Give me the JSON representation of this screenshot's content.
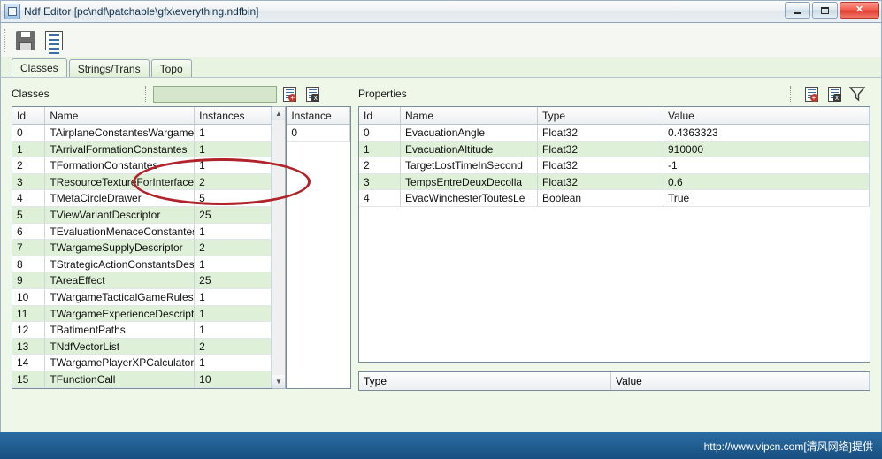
{
  "window": {
    "title": "Ndf Editor [pc\\ndf\\patchable\\gfx\\everything.ndfbin]",
    "icon": "app-icon",
    "minimize_label": "–",
    "maximize_label": "❐",
    "close_label": "✕"
  },
  "toolbar": {
    "save_icon": "save-icon",
    "list_icon": "list-icon"
  },
  "tabs": [
    {
      "label": "Classes",
      "active": true
    },
    {
      "label": "Strings/Trans",
      "active": false
    },
    {
      "label": "Topo",
      "active": false
    }
  ],
  "classes_pane": {
    "title": "Classes",
    "search_value": "",
    "search_placeholder": "",
    "add_icon": "doc-add-icon",
    "remove_icon": "doc-remove-icon",
    "columns": [
      "Id",
      "Name",
      "Instances"
    ],
    "instance_column": "Instance",
    "instance_rows": [
      "0"
    ],
    "rows": [
      {
        "id": "0",
        "name": "TAirplaneConstantesWargame",
        "instances": "1"
      },
      {
        "id": "1",
        "name": "TArrivalFormationConstantes",
        "instances": "1"
      },
      {
        "id": "2",
        "name": "TFormationConstantes",
        "instances": "1"
      },
      {
        "id": "3",
        "name": "TResourceTextureForInterface",
        "instances": "2"
      },
      {
        "id": "4",
        "name": "TMetaCircleDrawer",
        "instances": "5"
      },
      {
        "id": "5",
        "name": "TViewVariantDescriptor",
        "instances": "25"
      },
      {
        "id": "6",
        "name": "TEvaluationMenaceConstantes",
        "instances": "1"
      },
      {
        "id": "7",
        "name": "TWargameSupplyDescriptor",
        "instances": "2"
      },
      {
        "id": "8",
        "name": "TStrategicActionConstantsDes",
        "instances": "1"
      },
      {
        "id": "9",
        "name": "TAreaEffect",
        "instances": "25"
      },
      {
        "id": "10",
        "name": "TWargameTacticalGameRules",
        "instances": "1"
      },
      {
        "id": "11",
        "name": "TWargameExperienceDescripto",
        "instances": "1"
      },
      {
        "id": "12",
        "name": "TBatimentPaths",
        "instances": "1"
      },
      {
        "id": "13",
        "name": "TNdfVectorList",
        "instances": "2"
      },
      {
        "id": "14",
        "name": "TWargamePlayerXPCalculator",
        "instances": "1"
      },
      {
        "id": "15",
        "name": "TFunctionCall",
        "instances": "10"
      }
    ]
  },
  "properties_pane": {
    "title": "Properties",
    "add_icon": "doc-add-icon",
    "remove_icon": "doc-remove-icon",
    "filter_icon": "funnel-icon",
    "columns": [
      "Id",
      "Name",
      "Type",
      "Value"
    ],
    "rows": [
      {
        "id": "0",
        "name": "EvacuationAngle",
        "type": "Float32",
        "value": "0.4363323"
      },
      {
        "id": "1",
        "name": "EvacuationAltitude",
        "type": "Float32",
        "value": "910000"
      },
      {
        "id": "2",
        "name": "TargetLostTimeInSecond",
        "type": "Float32",
        "value": "-1"
      },
      {
        "id": "3",
        "name": "TempsEntreDeuxDecolla",
        "type": "Float32",
        "value": "0.6"
      },
      {
        "id": "4",
        "name": "EvacWinchesterToutesLe",
        "type": "Boolean",
        "value": "True"
      }
    ],
    "detail_columns": [
      "Type",
      "Value"
    ]
  },
  "statusbar": {
    "watermark": "http://www.vipcn.com[清风网络]提供"
  },
  "colors": {
    "accent": "#1f4e78",
    "highlight_ellipse": "#b0232a",
    "row_alt": "#dff0d8",
    "window_bg": "#e8f3e2"
  }
}
